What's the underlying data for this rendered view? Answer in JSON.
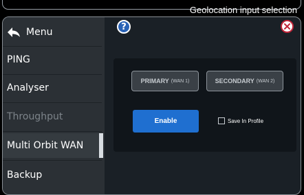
{
  "caption": "Geolocation input selection",
  "sidebar": {
    "menu_label": "Menu",
    "items": [
      {
        "label": "PING"
      },
      {
        "label": "Analyser"
      },
      {
        "label": "Throughput"
      },
      {
        "label": "Multi Orbit WAN"
      },
      {
        "label": "Backup"
      }
    ]
  },
  "header": {
    "help_icon": "?"
  },
  "wan": {
    "primary_label": "PRIMARY",
    "primary_sub": "(WAN 1)",
    "secondary_label": "SECONDARY",
    "secondary_sub": "(WAN 2)"
  },
  "actions": {
    "enable_label": "Enable",
    "save_profile_label": "Save In Profile"
  }
}
